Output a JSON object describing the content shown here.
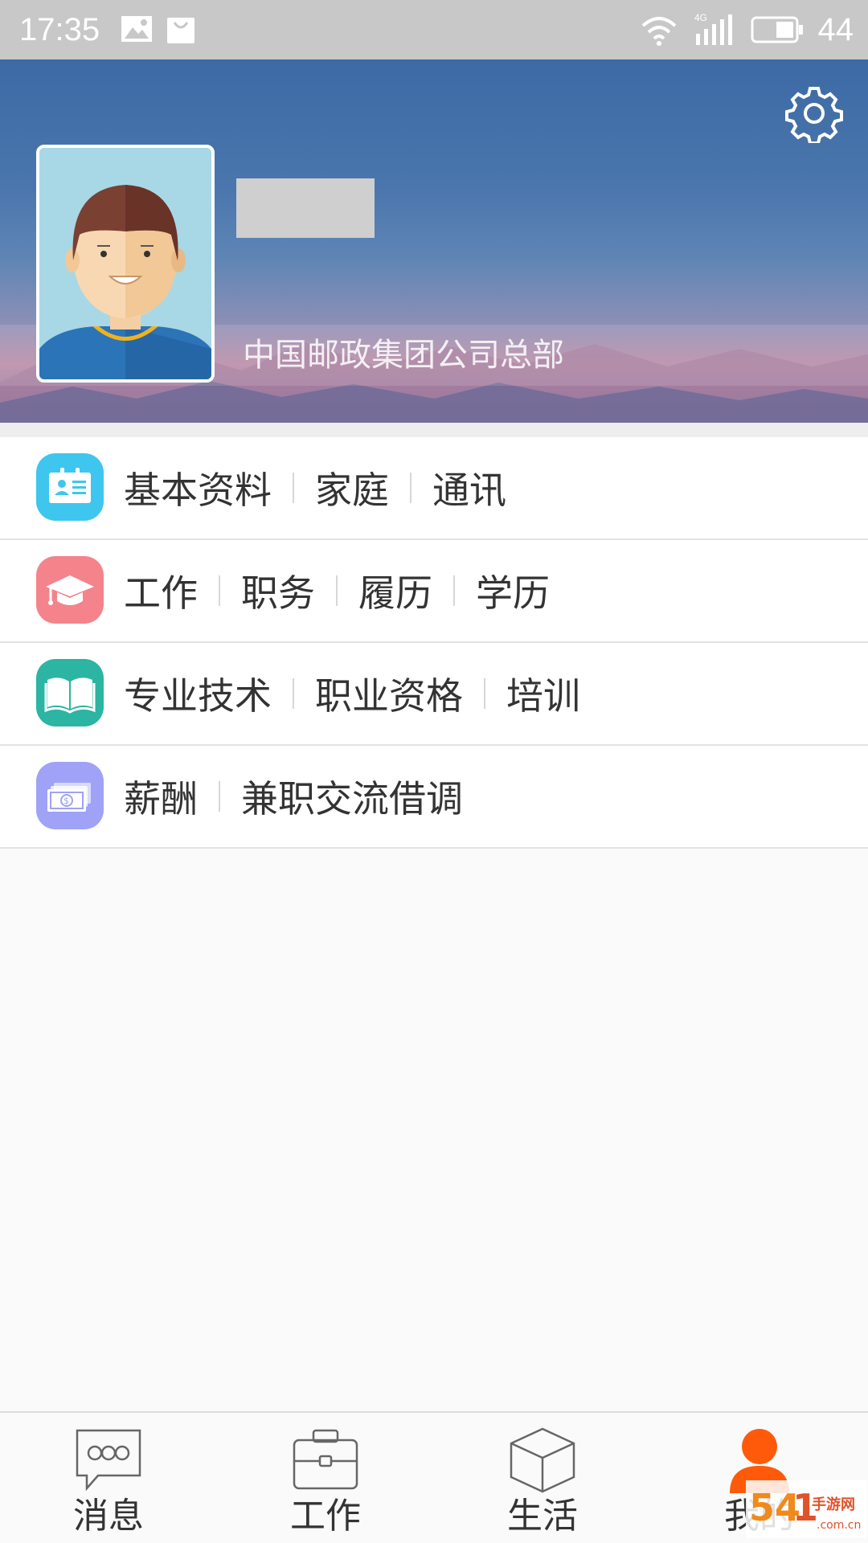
{
  "status_bar": {
    "time": "17:35",
    "network": "4G",
    "battery": "44",
    "icons": [
      "image-icon",
      "bag-icon",
      "wifi-icon",
      "signal-icon",
      "battery-icon"
    ]
  },
  "header": {
    "org_name": "中国邮政集团公司总部",
    "icons": [
      "gear-icon",
      "avatar"
    ]
  },
  "menu": {
    "rows": [
      {
        "icon": "id-card-icon",
        "color": "#3fc6ee",
        "links": [
          "基本资料",
          "家庭",
          "通讯"
        ]
      },
      {
        "icon": "graduation-cap-icon",
        "color": "#f4838c",
        "links": [
          "工作",
          "职务",
          "履历",
          "学历"
        ]
      },
      {
        "icon": "book-icon",
        "color": "#2bb5a2",
        "links": [
          "专业技术",
          "职业资格",
          "培训"
        ]
      },
      {
        "icon": "money-icon",
        "color": "#9fa2f6",
        "links": [
          "薪酬",
          "兼职交流借调"
        ]
      }
    ]
  },
  "bottom_nav": {
    "items": [
      {
        "label": "消息",
        "icon": "chat-bubble-icon"
      },
      {
        "label": "工作",
        "icon": "briefcase-icon"
      },
      {
        "label": "生活",
        "icon": "cube-icon"
      },
      {
        "label": "我的",
        "icon": "person-icon",
        "active": true
      }
    ],
    "active_color": "#ff5a0a"
  },
  "watermark": {
    "text": "手游网",
    "domain": ".com.cn",
    "logo_text": "5418"
  }
}
